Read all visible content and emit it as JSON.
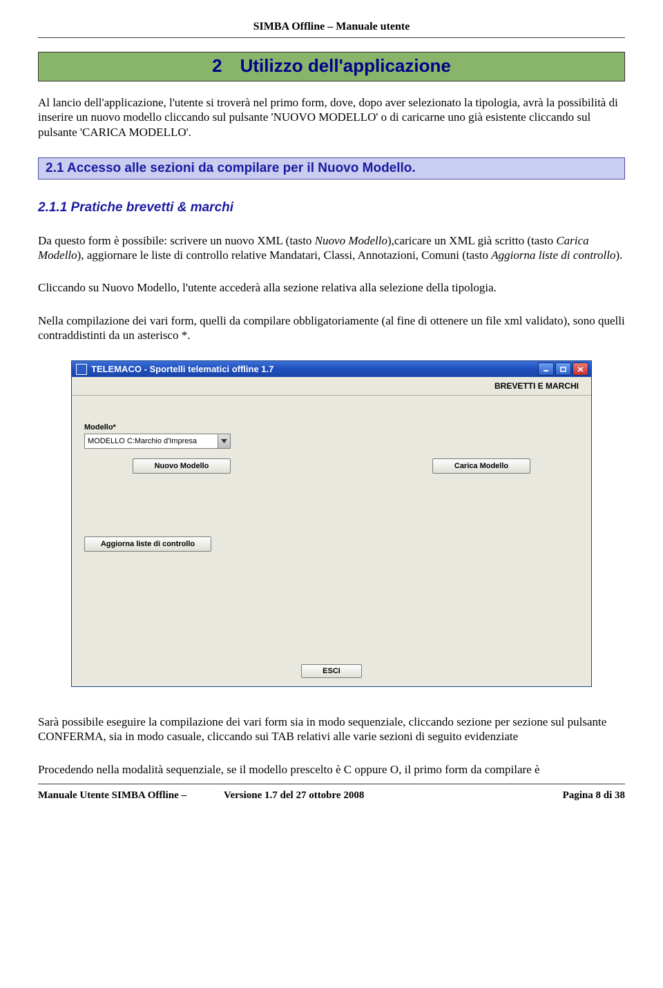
{
  "doc_header": "SIMBA Offline – Manuale utente",
  "section_h1": "2 Utilizzo dell'applicazione",
  "intro": "Al lancio dell'applicazione, l'utente si troverà nel primo form, dove, dopo aver selezionato la tipologia, avrà la possibilità di inserire un nuovo modello cliccando sul pulsante 'NUOVO MODELLO' o di caricarne uno già esistente cliccando sul pulsante 'CARICA MODELLO'.",
  "section_h2": "2.1 Accesso alle sezioni da compilare per il Nuovo Modello.",
  "section_h3": "2.1.1 Pratiche brevetti & marchi",
  "p1_a": "Da questo form è possibile: scrivere un nuovo XML (tasto ",
  "p1_em1": "Nuovo Modello",
  "p1_b": "),caricare un XML già scritto (tasto ",
  "p1_em2": "Carica Modello",
  "p1_c": "), aggiornare le liste di controllo relative Mandatari, Classi, Annotazioni, Comuni (tasto ",
  "p1_em3": "Aggiorna liste di controllo",
  "p1_d": ").",
  "p2": "Cliccando su Nuovo Modello, l'utente accederà alla sezione relativa alla selezione della tipologia.",
  "p3": "Nella compilazione dei vari form, quelli da compilare obbligatoriamente (al fine di ottenere un file xml validato), sono quelli contraddistinti da un asterisco *.",
  "p4": "Sarà possibile eseguire la compilazione dei vari form sia in modo sequenziale, cliccando sezione per sezione sul pulsante CONFERMA, sia in modo casuale, cliccando sui TAB relativi alle varie sezioni di seguito evidenziate",
  "p5": "Procedendo nella modalità sequenziale, se il modello prescelto è C oppure O, il primo form da compilare è",
  "app": {
    "title": "TELEMACO - Sportelli telematici offline 1.7",
    "subheader": "BREVETTI E MARCHI",
    "modello_label": "Modello*",
    "modello_value": "MODELLO C:Marchio d'Impresa",
    "btn_nuovo": "Nuovo Modello",
    "btn_carica": "Carica Modello",
    "btn_aggiorna": "Aggiorna liste di controllo",
    "btn_esci": "ESCI"
  },
  "footer": {
    "left": "Manuale Utente SIMBA Offline –",
    "mid": "Versione  1.7 del  27 ottobre 2008",
    "right": "Pagina 8  di  38"
  }
}
